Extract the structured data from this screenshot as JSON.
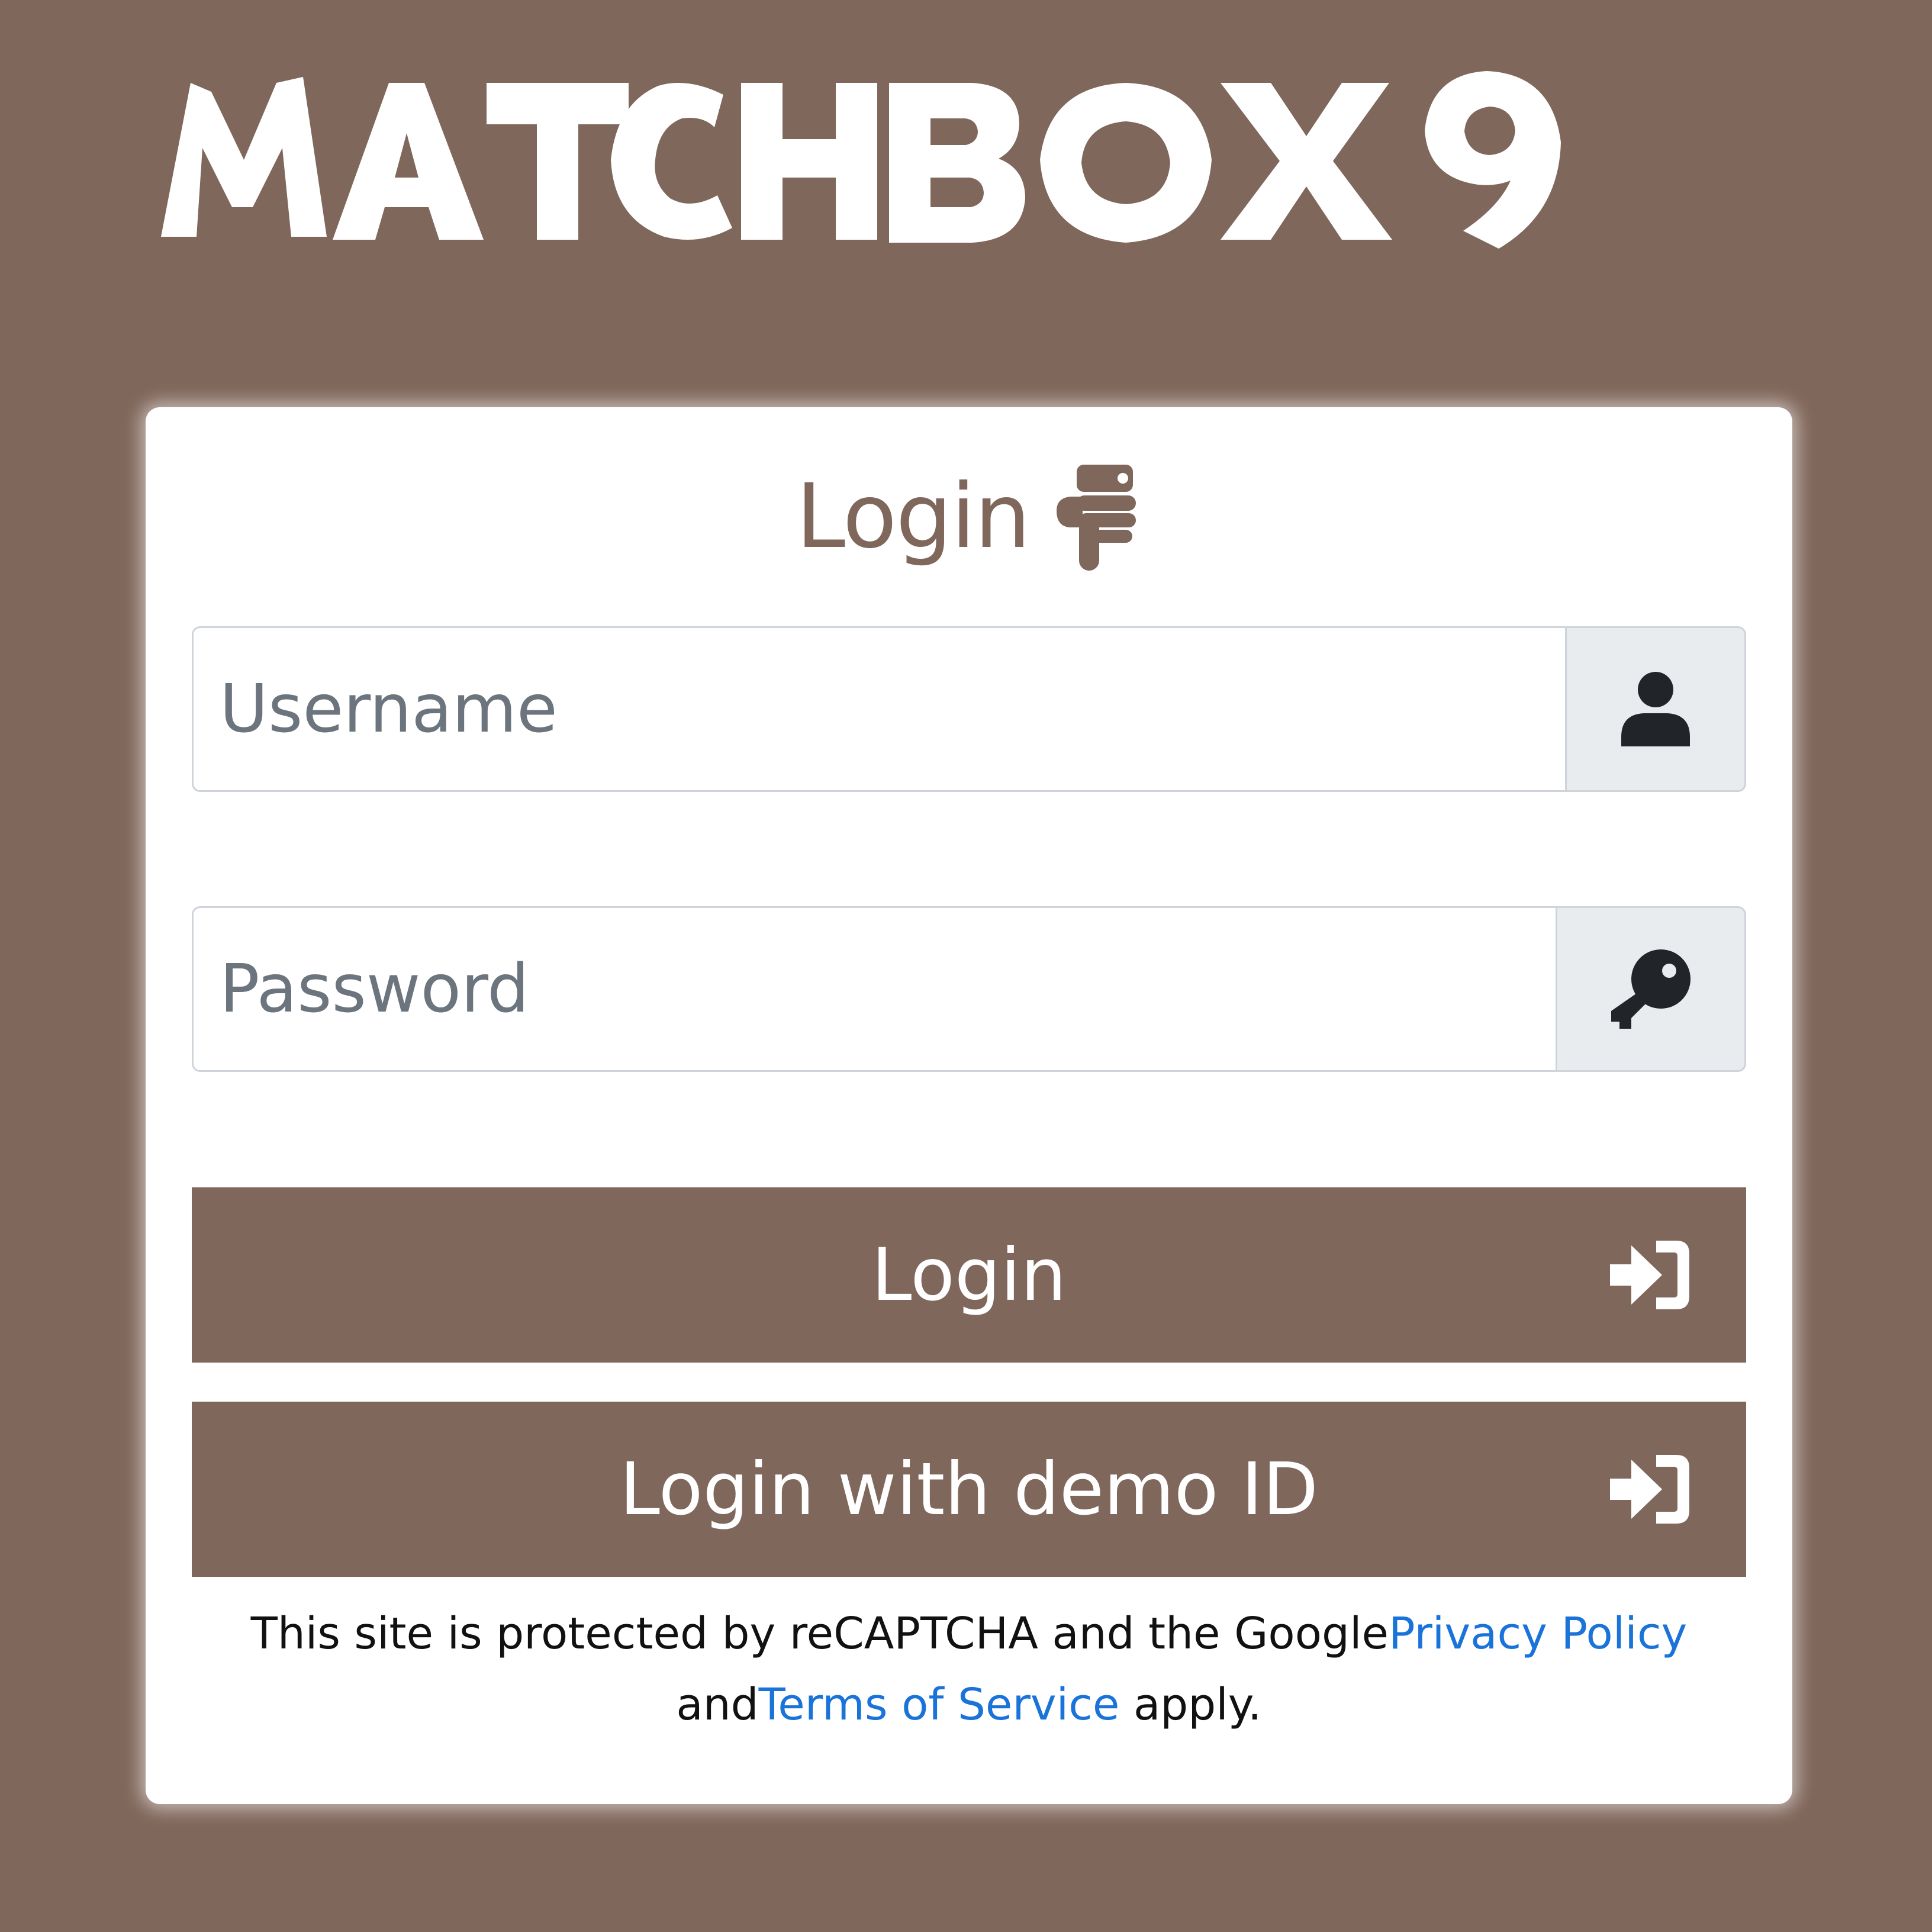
{
  "brand": {
    "logo_text": "MATCHBOX9"
  },
  "login_card": {
    "title": "Login",
    "title_icon": "hand-point-down-icon",
    "username": {
      "placeholder": "Username",
      "value": "",
      "icon": "user-icon"
    },
    "password": {
      "placeholder": "Password",
      "value": "",
      "icon": "key-icon"
    },
    "login_button": {
      "label": "Login",
      "icon": "sign-in-icon"
    },
    "demo_button": {
      "label": "Login with demo ID",
      "icon": "sign-in-icon"
    },
    "recaptcha_notice": {
      "prefix": "This site is protected by reCAPTCHA and the Google",
      "privacy_link": "Privacy Policy",
      "middle": " and",
      "terms_link": "Terms of Service",
      "suffix": " apply."
    }
  },
  "colors": {
    "background": "#80675b",
    "card": "#ffffff",
    "button": "#80675b",
    "link": "#1a73d8",
    "addon_bg": "#e9ecef"
  }
}
